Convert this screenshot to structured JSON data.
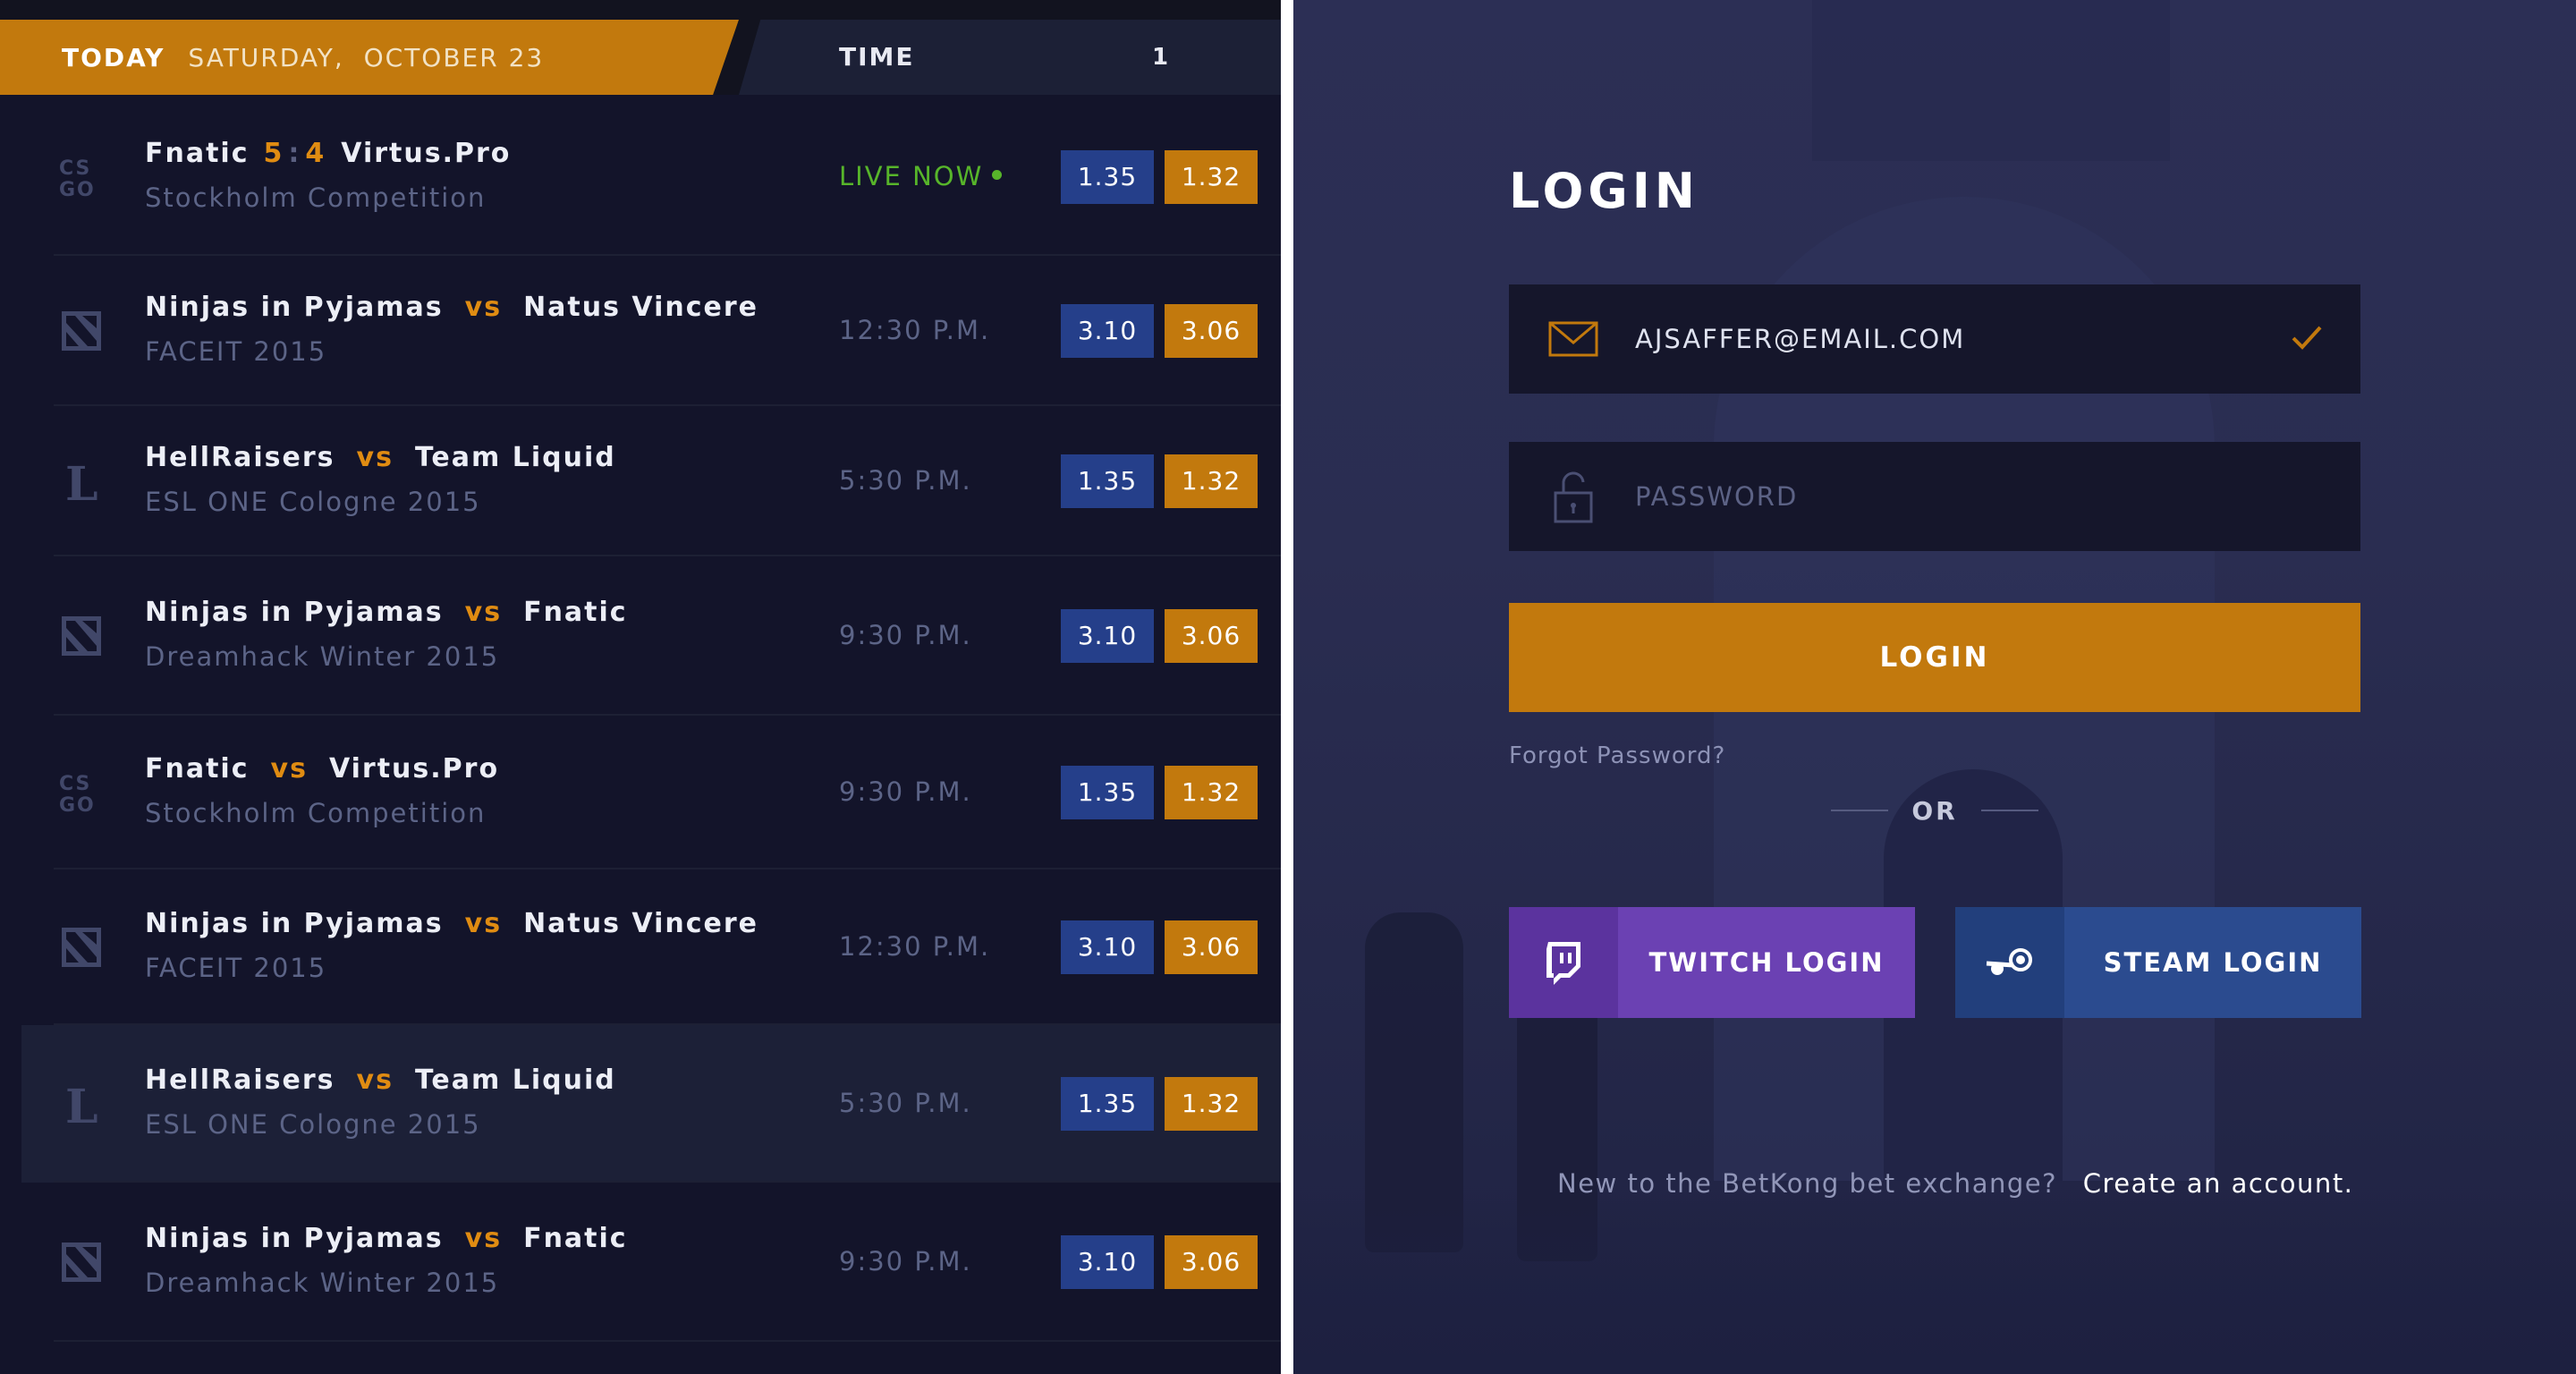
{
  "header": {
    "today_label": "TODAY",
    "date": "SATURDAY,  OCTOBER 23",
    "time_label": "TIME",
    "count": "1"
  },
  "matches": [
    {
      "game": "csgo",
      "team1": "Fnatic",
      "score1": "5",
      "score2": "4",
      "team2": "Virtus.Pro",
      "event": "Stockholm Competition",
      "time": "LIVE NOW",
      "live": true,
      "odd1": "1.35",
      "odd2": "1.32"
    },
    {
      "game": "dota",
      "team1": "Ninjas in Pyjamas",
      "vs": "vs",
      "team2": "Natus Vincere",
      "event": "FACEIT 2015",
      "time": "12:30 P.M.",
      "odd1": "3.10",
      "odd2": "3.06"
    },
    {
      "game": "lol",
      "team1": "HellRaisers",
      "vs": "vs",
      "team2": "Team Liquid",
      "event": "ESL ONE Cologne 2015",
      "time": "5:30 P.M.",
      "odd1": "1.35",
      "odd2": "1.32"
    },
    {
      "game": "dota",
      "team1": "Ninjas in Pyjamas",
      "vs": "vs",
      "team2": "Fnatic",
      "event": "Dreamhack Winter 2015",
      "time": "9:30 P.M.",
      "odd1": "3.10",
      "odd2": "3.06"
    },
    {
      "game": "csgo",
      "team1": "Fnatic",
      "vs": "vs",
      "team2": "Virtus.Pro",
      "event": "Stockholm Competition",
      "time": "9:30 P.M.",
      "odd1": "1.35",
      "odd2": "1.32"
    },
    {
      "game": "dota",
      "team1": "Ninjas in Pyjamas",
      "vs": "vs",
      "team2": "Natus Vincere",
      "event": "FACEIT 2015",
      "time": "12:30 P.M.",
      "odd1": "3.10",
      "odd2": "3.06"
    },
    {
      "game": "lol",
      "team1": "HellRaisers",
      "vs": "vs",
      "team2": "Team Liquid",
      "event": "ESL ONE Cologne 2015",
      "time": "5:30 P.M.",
      "odd1": "1.35",
      "odd2": "1.32"
    },
    {
      "game": "dota",
      "team1": "Ninjas in Pyjamas",
      "vs": "vs",
      "team2": "Fnatic",
      "event": "Dreamhack Winter 2015",
      "time": "9:30 P.M.",
      "odd1": "3.10",
      "odd2": "3.06"
    }
  ],
  "login": {
    "title": "LOGIN",
    "email_value": "AJSAFFER@EMAIL.COM",
    "password_placeholder": "PASSWORD",
    "button": "LOGIN",
    "forgot": "Forgot Password?",
    "or": "OR",
    "twitch": "TWITCH LOGIN",
    "steam": "STEAM LOGIN",
    "signup_question": "New to the BetKong bet exchange?",
    "signup_link": "Create an account."
  },
  "colors": {
    "accent": "#c2790d",
    "odds_blue": "#253f8a",
    "live_green": "#57b52a",
    "twitch": "#6b41b3",
    "steam": "#2b4b8f"
  },
  "icons": {
    "email": "envelope-icon",
    "password": "padlock-icon",
    "valid": "checkmark-icon",
    "twitch": "twitch-icon",
    "steam": "steam-icon"
  }
}
